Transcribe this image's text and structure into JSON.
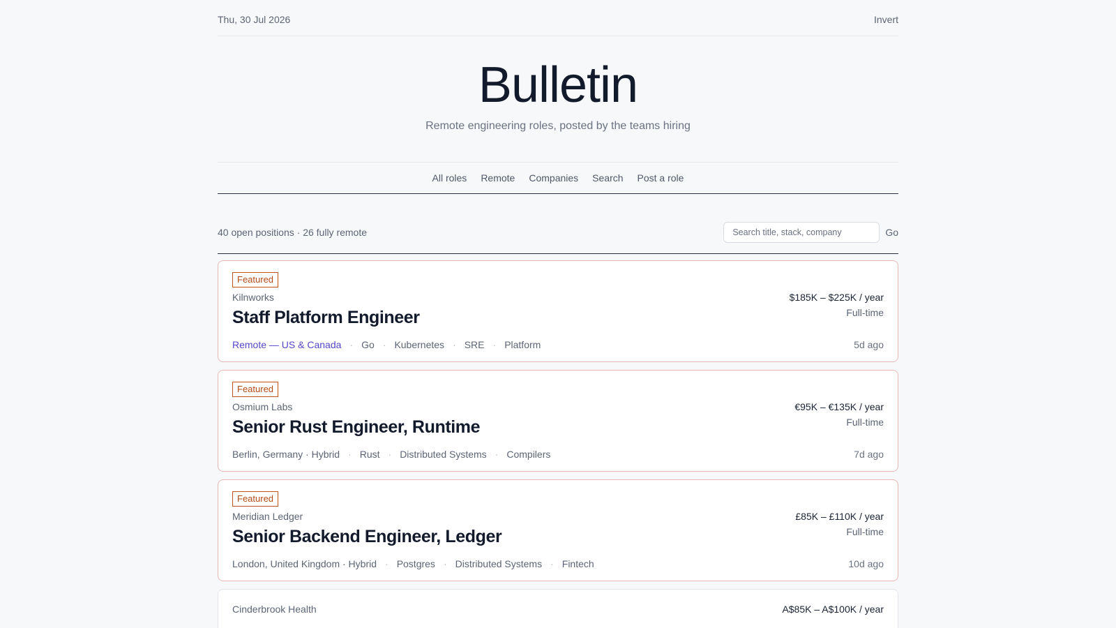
{
  "topbar": {
    "date": "Thu, 30 Jul 2026",
    "invert_label": "Invert"
  },
  "masthead": {
    "title": "Bulletin",
    "tagline": "Remote engineering roles, posted by the teams hiring"
  },
  "nav": {
    "items": [
      "All roles",
      "Remote",
      "Companies",
      "Search",
      "Post a role"
    ]
  },
  "toolbar": {
    "summary": "40 open positions · 26 fully remote",
    "search_placeholder": "Search title, stack, company",
    "search_value": "",
    "go_label": "Go"
  },
  "jobs": [
    {
      "featured": "Featured",
      "company": "Kilnworks",
      "salary": "$185K – $225K / year",
      "title": "Staff Platform Engineer",
      "type": "Full-time",
      "location": "Remote — US & Canada",
      "tags": [
        "Go",
        "Kubernetes",
        "SRE",
        "Platform"
      ],
      "posted": "5d ago"
    },
    {
      "featured": "Featured",
      "company": "Osmium Labs",
      "salary": "€95K – €135K / year",
      "title": "Senior Rust Engineer, Runtime",
      "type": "Full-time",
      "location": "Berlin, Germany · Hybrid",
      "tags": [
        "Rust",
        "Distributed Systems",
        "Compilers"
      ],
      "posted": "7d ago"
    },
    {
      "featured": "Featured",
      "company": "Meridian Ledger",
      "salary": "£85K – £110K / year",
      "title": "Senior Backend Engineer, Ledger",
      "type": "Full-time",
      "location": "London, United Kingdom · Hybrid",
      "tags": [
        "Postgres",
        "Distributed Systems",
        "Fintech"
      ],
      "posted": "10d ago"
    },
    {
      "company": "Cinderbrook Health",
      "salary": "A$85K – A$100K / year"
    }
  ],
  "colors": {
    "accent_remote": "#5446c9",
    "featured_border": "#c1531b",
    "card_featured_border": "#e6b7b4"
  }
}
